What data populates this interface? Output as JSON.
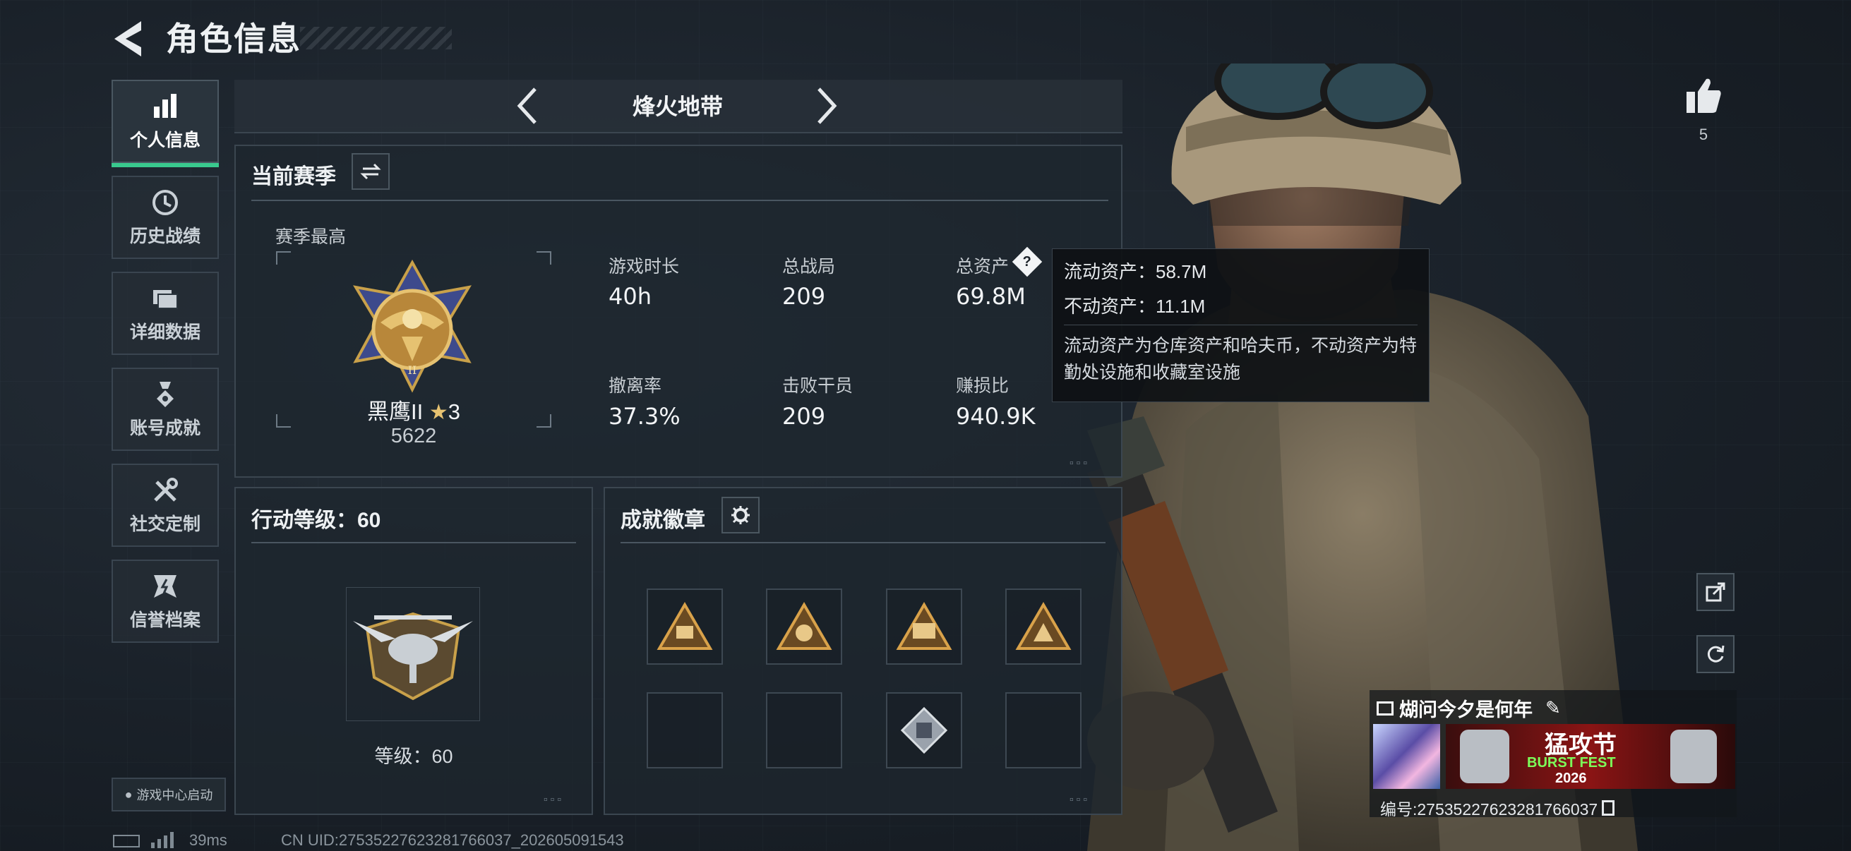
{
  "header": {
    "title": "角色信息"
  },
  "sidebar": {
    "items": [
      {
        "label": "个人信息",
        "icon": "bar-chart-icon",
        "active": true
      },
      {
        "label": "历史战绩",
        "icon": "history-icon"
      },
      {
        "label": "详细数据",
        "icon": "folder-icon"
      },
      {
        "label": "账号成就",
        "icon": "medal-icon"
      },
      {
        "label": "社交定制",
        "icon": "tools-icon"
      },
      {
        "label": "信誉档案",
        "icon": "credit-icon"
      }
    ],
    "launch_label": "游戏中心启动"
  },
  "mode_selector": {
    "label": "烽火地带"
  },
  "season": {
    "title": "当前赛季",
    "best_label": "赛季最高",
    "rank_name": "黑鹰II",
    "rank_stars": "3",
    "rank_score": "5622",
    "stats": [
      {
        "label": "游戏时长",
        "value": "40h"
      },
      {
        "label": "总战局",
        "value": "209"
      },
      {
        "label": "总资产",
        "value": "69.8M"
      },
      {
        "label": "撤离率",
        "value": "37.3%"
      },
      {
        "label": "击败干员",
        "value": "209"
      },
      {
        "label": "赚损比",
        "value": "940.9K"
      }
    ]
  },
  "tooltip": {
    "liquid": "流动资产：58.7M",
    "fixed": "不动资产：11.1M",
    "note": "流动资产为仓库资产和哈夫币，不动资产为特勤处设施和收藏室设施"
  },
  "action_level": {
    "title": "行动等级：60",
    "level_label": "等级：60"
  },
  "achievements": {
    "title": "成就徽章",
    "slots": 8
  },
  "right": {
    "likes": "5",
    "player_name": "煳问今夕是何年",
    "banner_text_1": "猛攻节",
    "banner_text_2": "BURST FEST",
    "banner_text_3": "2026",
    "player_id": "编号:2753522762328176603​7"
  },
  "footer": {
    "ping": "39ms",
    "uid": "CN UID:2753522762328176603​7_202605091543"
  },
  "colors": {
    "accent": "#39c98e",
    "panel_border": "#3b4650",
    "gold": "#c9a14a"
  }
}
